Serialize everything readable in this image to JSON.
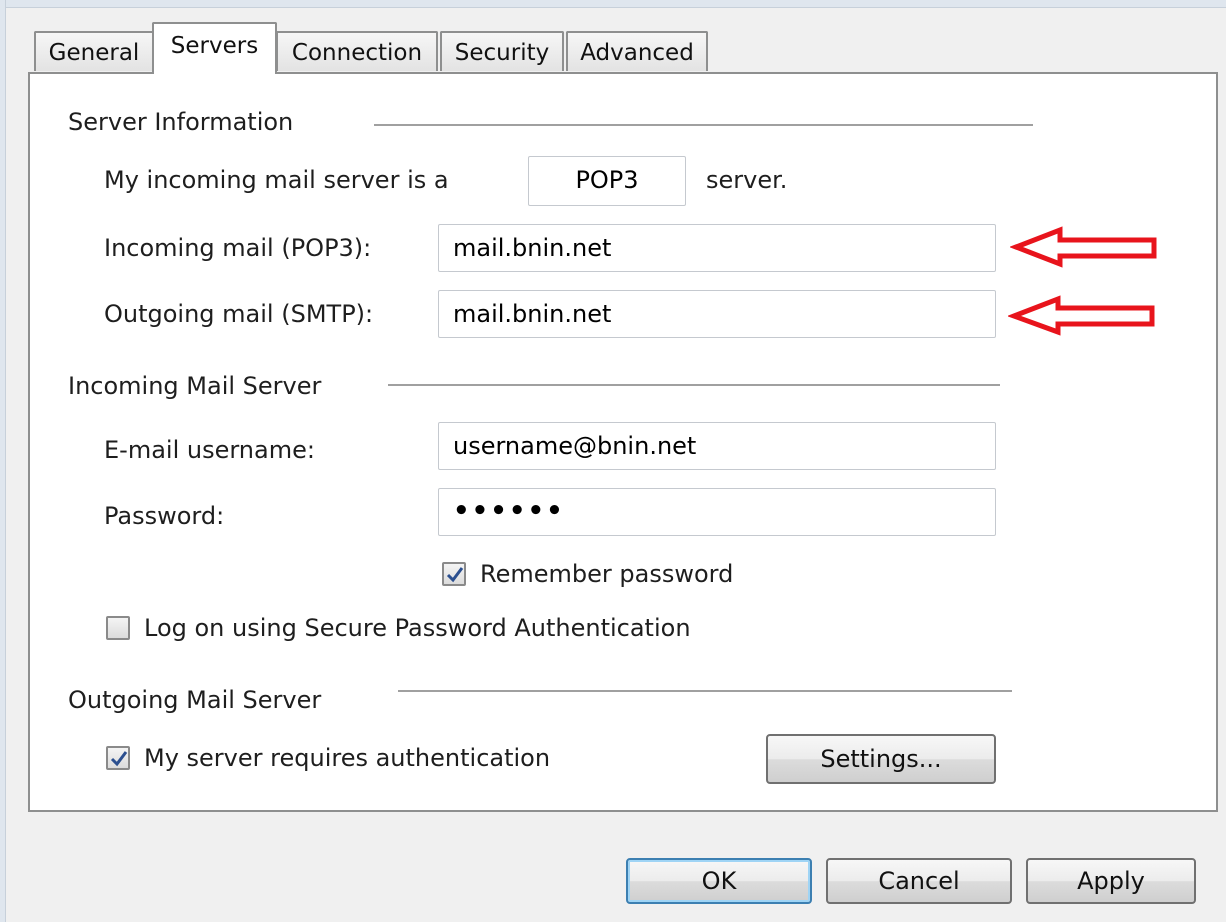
{
  "tabs": [
    {
      "label": "General"
    },
    {
      "label": "Servers"
    },
    {
      "label": "Connection"
    },
    {
      "label": "Security"
    },
    {
      "label": "Advanced"
    }
  ],
  "server_information": {
    "title": "Server Information",
    "incoming_type_prefix": "My incoming mail server is a",
    "incoming_type_value": "POP3",
    "incoming_type_suffix": "server.",
    "incoming_label": "Incoming mail (POP3):",
    "incoming_value": "mail.bnin.net",
    "outgoing_label": "Outgoing mail (SMTP):",
    "outgoing_value": "mail.bnin.net"
  },
  "incoming_mail_server": {
    "title": "Incoming Mail Server",
    "username_label": "E-mail username:",
    "username_value": "username@bnin.net",
    "password_label": "Password:",
    "password_value": "••••••",
    "remember_label": "Remember password",
    "remember_checked": true,
    "spa_label": "Log on using Secure Password Authentication",
    "spa_checked": false
  },
  "outgoing_mail_server": {
    "title": "Outgoing Mail Server",
    "auth_label": "My server requires authentication",
    "auth_checked": true,
    "settings_label": "Settings..."
  },
  "buttons": {
    "ok": "OK",
    "cancel": "Cancel",
    "apply": "Apply"
  },
  "colors": {
    "annotation_arrow": "#e8141c",
    "checkmark": "#2b4f8f"
  },
  "icons": {
    "annotation": "left-arrow-icon",
    "check": "checkmark-icon"
  }
}
